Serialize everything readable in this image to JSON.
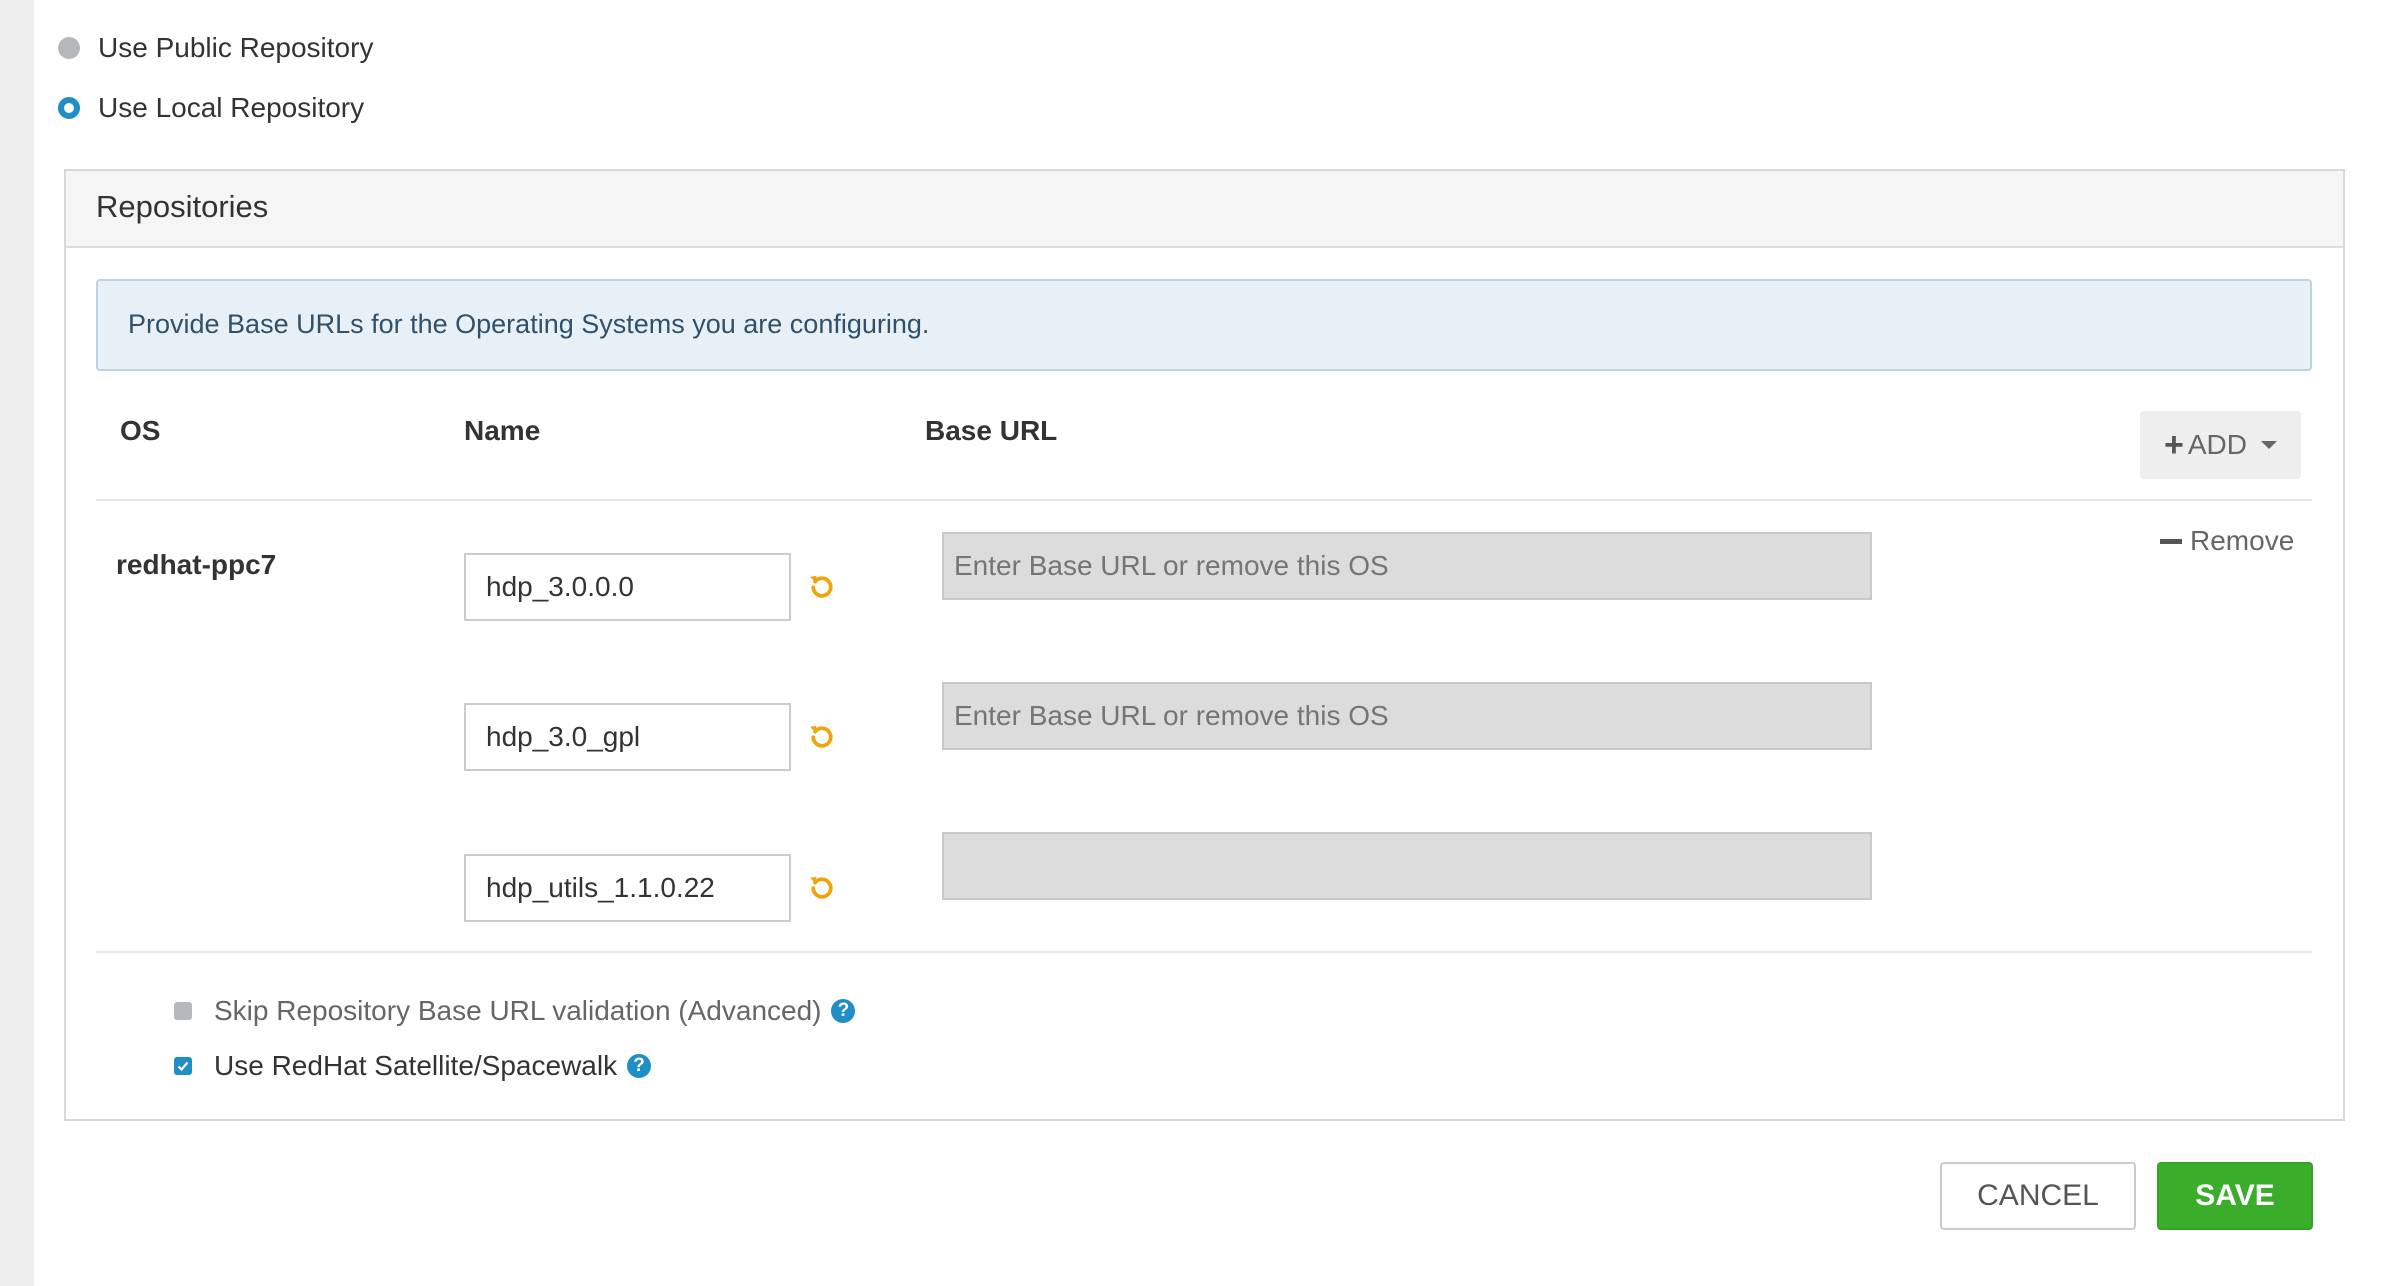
{
  "repo_source": {
    "options": [
      {
        "label": "Use Public Repository",
        "selected": false
      },
      {
        "label": "Use Local Repository",
        "selected": true
      }
    ]
  },
  "panel": {
    "title": "Repositories",
    "info": "Provide Base URLs for the Operating Systems you are configuring.",
    "columns": {
      "os": "OS",
      "name": "Name",
      "base_url": "Base URL"
    },
    "add_label": "ADD",
    "os_entry": {
      "os": "redhat-ppc7",
      "remove_label": "Remove",
      "repos": [
        {
          "name": "hdp_3.0.0.0",
          "base_url": "",
          "placeholder": "Enter Base URL or remove this OS"
        },
        {
          "name": "hdp_3.0_gpl",
          "base_url": "",
          "placeholder": "Enter Base URL or remove this OS"
        },
        {
          "name": "hdp_utils_1.1.0.22",
          "base_url": "",
          "placeholder": ""
        }
      ]
    },
    "checkboxes": [
      {
        "label": "Skip Repository Base URL validation (Advanced)",
        "checked": false
      },
      {
        "label": "Use RedHat Satellite/Spacewalk",
        "checked": true
      }
    ]
  },
  "actions": {
    "cancel_label": "CANCEL",
    "save_label": "SAVE"
  },
  "icons": {
    "undo": "undo-icon",
    "help": "question-circle-icon",
    "add": "plus-icon",
    "remove": "minus-icon",
    "dropdown": "caret-down-icon"
  },
  "colors": {
    "accent": "#1f8ec7",
    "save": "#3aae2a",
    "undo": "#f0a30a",
    "info_bg": "#e6f0f6"
  }
}
